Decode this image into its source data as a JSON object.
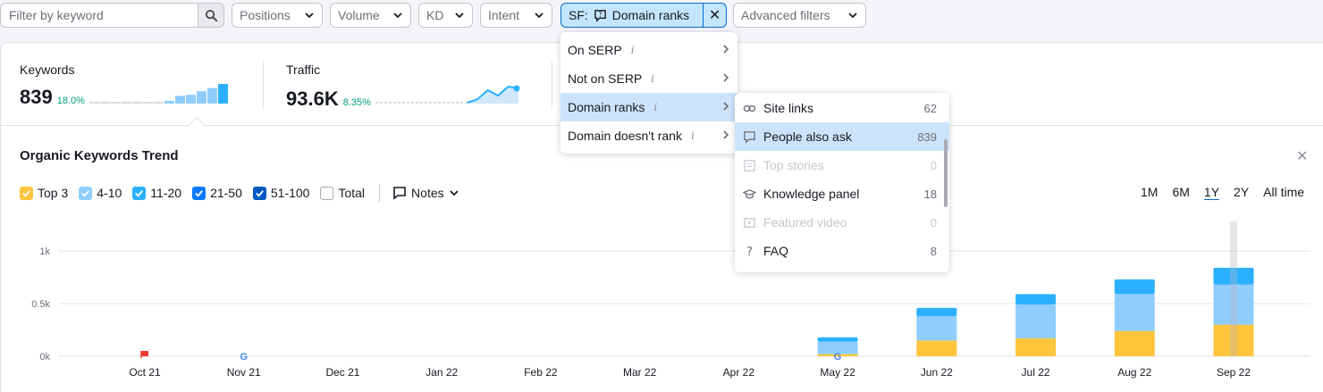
{
  "filters": {
    "search_placeholder": "Filter by keyword",
    "positions": "Positions",
    "volume": "Volume",
    "kd": "KD",
    "intent": "Intent",
    "sf_prefix": "SF:",
    "sf_value": "Domain ranks",
    "advanced": "Advanced filters"
  },
  "summary": {
    "keywords_label": "Keywords",
    "keywords_value": "839",
    "keywords_pct": "18.0%",
    "traffic_label": "Traffic",
    "traffic_value": "93.6K",
    "traffic_pct": "8.35%"
  },
  "trend": {
    "title": "Organic Keywords Trend",
    "legend": [
      {
        "label": "Top 3",
        "color": "#ffc53d",
        "checked": true
      },
      {
        "label": "4-10",
        "color": "#8fcdff",
        "checked": true
      },
      {
        "label": "11-20",
        "color": "#2bb0ff",
        "checked": true
      },
      {
        "label": "21-50",
        "color": "#0a7bff",
        "checked": true
      },
      {
        "label": "51-100",
        "color": "#005ac4",
        "checked": true
      },
      {
        "label": "Total",
        "color": "#ffffff",
        "checked": false
      }
    ],
    "notes_label": "Notes",
    "ranges": [
      "1M",
      "6M",
      "1Y",
      "2Y",
      "All time"
    ],
    "active_range": "1Y"
  },
  "dropdown_sf": [
    {
      "label": "On SERP",
      "active": false
    },
    {
      "label": "Not on SERP",
      "active": false
    },
    {
      "label": "Domain ranks",
      "active": true
    },
    {
      "label": "Domain doesn't rank",
      "active": false
    }
  ],
  "dropdown_features": [
    {
      "label": "Site links",
      "count": "62",
      "icon": "link-icon",
      "disabled": false,
      "active": false
    },
    {
      "label": "People also ask",
      "count": "839",
      "icon": "question-bubble-icon",
      "disabled": false,
      "active": true
    },
    {
      "label": "Top stories",
      "count": "0",
      "icon": "news-icon",
      "disabled": true,
      "active": false
    },
    {
      "label": "Knowledge panel",
      "count": "18",
      "icon": "graduation-cap-icon",
      "disabled": false,
      "active": false
    },
    {
      "label": "Featured video",
      "count": "0",
      "icon": "video-icon",
      "disabled": true,
      "active": false
    },
    {
      "label": "FAQ",
      "count": "8",
      "icon": "question-mark-icon",
      "disabled": false,
      "active": false
    }
  ],
  "chart_data": {
    "type": "bar",
    "stacked": true,
    "categories": [
      "Oct 21",
      "Nov 21",
      "Dec 21",
      "Jan 22",
      "Feb 22",
      "Mar 22",
      "Apr 22",
      "May 22",
      "Jun 22",
      "Jul 22",
      "Aug 22",
      "Sep 22"
    ],
    "series": [
      {
        "name": "Top 3",
        "color": "#ffc53d",
        "values": [
          0,
          0,
          0,
          0,
          0,
          0,
          0,
          20,
          150,
          170,
          240,
          300
        ]
      },
      {
        "name": "4-10",
        "color": "#8fcdff",
        "values": [
          0,
          0,
          0,
          0,
          0,
          0,
          0,
          120,
          230,
          320,
          350,
          380
        ]
      },
      {
        "name": "11-20",
        "color": "#2bb0ff",
        "values": [
          0,
          0,
          0,
          0,
          0,
          0,
          0,
          40,
          80,
          100,
          140,
          160
        ]
      }
    ],
    "y_ticks": [
      "0k",
      "0.5k",
      "1k"
    ],
    "ylim": [
      0,
      1000
    ],
    "grid": true,
    "markers": [
      {
        "category": "Oct 21",
        "icon": "flag-icon"
      },
      {
        "category": "Nov 21",
        "icon": "google-icon"
      },
      {
        "category": "May 22",
        "icon": "google-icon"
      }
    ],
    "sparkline_keywords": [
      0,
      0,
      0,
      0,
      0,
      0,
      0,
      20,
      150,
      170,
      240,
      300,
      380
    ],
    "sparkline_traffic": [
      0,
      0,
      0,
      0,
      0,
      0,
      0,
      0,
      0,
      0,
      20,
      70,
      40,
      90,
      80
    ]
  }
}
